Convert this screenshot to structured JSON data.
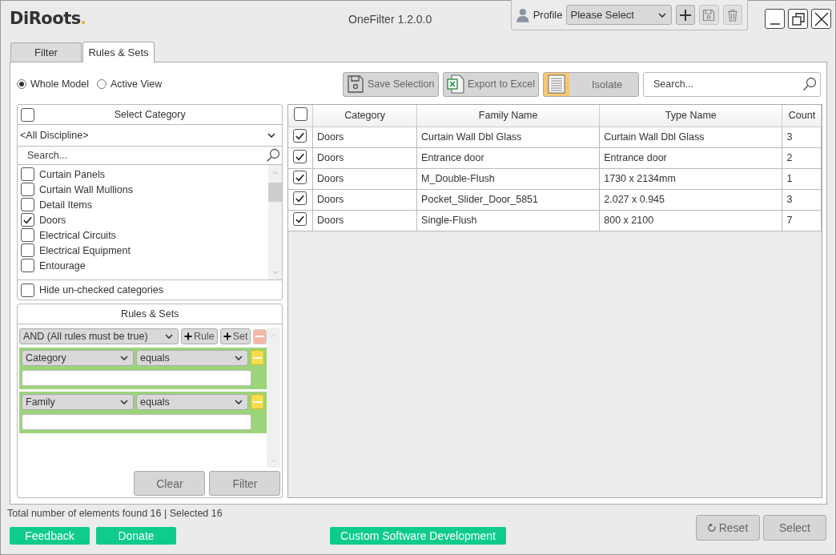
{
  "app": {
    "logo": "DiRoots",
    "title": "OneFilter 1.2.0.0"
  },
  "profile": {
    "label": "Profile",
    "select": "Please Select"
  },
  "tabs": [
    {
      "label": "Filter",
      "selected": false
    },
    {
      "label": "Rules & Sets",
      "selected": true
    }
  ],
  "scope": [
    {
      "label": "Whole Model",
      "selected": true
    },
    {
      "label": "Active View",
      "selected": false
    }
  ],
  "toolbar": {
    "buttons": [
      {
        "kind": "save",
        "label": "Save Selection"
      },
      {
        "kind": "excel",
        "label": "Export to Excel"
      },
      {
        "kind": "isolate",
        "label": "Isolate"
      }
    ],
    "search_placeholder": "Search..."
  },
  "categories": {
    "title": "Select Category",
    "all_checked": false,
    "discipline": "<All Discipline>",
    "search_placeholder": "Search...",
    "items": [
      {
        "label": "Curtain Panels",
        "checked": false
      },
      {
        "label": "Curtain Wall Mullions",
        "checked": false
      },
      {
        "label": "Detail Items",
        "checked": false
      },
      {
        "label": "Doors",
        "checked": true
      },
      {
        "label": "Electrical Circuits",
        "checked": false
      },
      {
        "label": "Electrical Equipment",
        "checked": false
      },
      {
        "label": "Entourage",
        "checked": false
      }
    ],
    "hide_unchecked": {
      "label": "Hide un-checked categories",
      "checked": false
    }
  },
  "rules": {
    "title": "Rules & Sets",
    "operator": "AND (All rules must be true)",
    "add_rule": "Rule",
    "add_set": "Set",
    "rules": [
      {
        "field": "Category",
        "condition": "equals"
      },
      {
        "field": "Family",
        "condition": "equals"
      }
    ],
    "buttons": [
      "Clear",
      "Filter"
    ]
  },
  "table": {
    "all_checked": false,
    "columns": [
      "Category",
      "Family Name",
      "Type Name",
      "Count"
    ],
    "rows": [
      {
        "checked": true,
        "cells": [
          "Doors",
          "Curtain Wall Dbl Glass",
          "Curtain Wall Dbl Glass",
          "3"
        ]
      },
      {
        "checked": true,
        "cells": [
          "Doors",
          "Entrance door",
          "Entrance door",
          "2"
        ]
      },
      {
        "checked": true,
        "cells": [
          "Doors",
          "M_Double-Flush",
          "1730 x 2134mm",
          "1"
        ]
      },
      {
        "checked": true,
        "cells": [
          "Doors",
          "Pocket_Slider_Door_5851",
          "2.027 x 0.945",
          "3"
        ]
      },
      {
        "checked": true,
        "cells": [
          "Doors",
          "Single-Flush",
          "800 x 2100",
          "7"
        ]
      }
    ]
  },
  "status": "Total number of elements found 16 | Selected 16",
  "footer": {
    "links": [
      "Feedback",
      "Donate",
      "Custom Software Development"
    ],
    "buttons": [
      {
        "kind": "reset",
        "label": "Reset"
      },
      {
        "kind": "select",
        "label": "Select"
      }
    ]
  }
}
